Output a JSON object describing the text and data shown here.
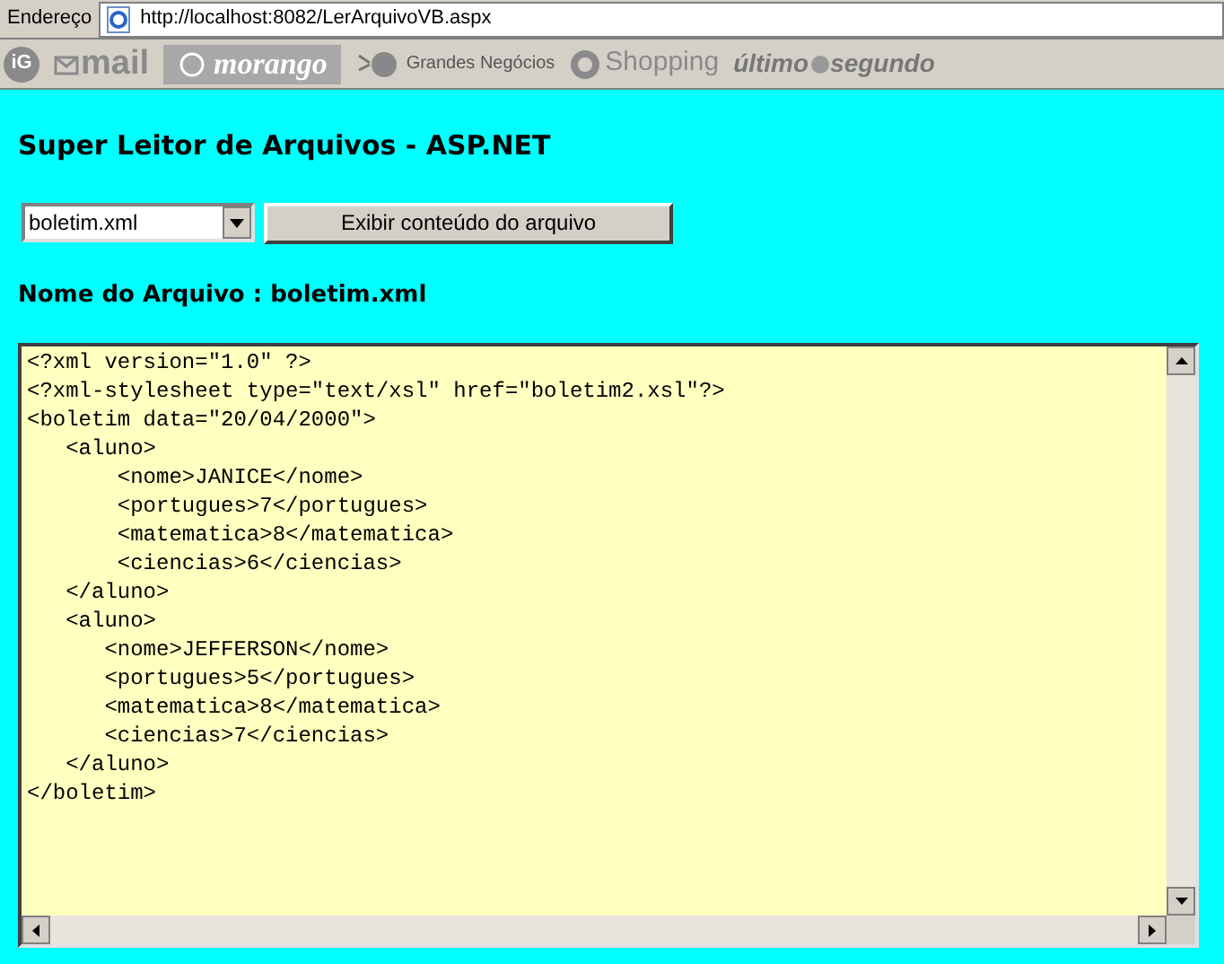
{
  "address_bar": {
    "label": "Endereço",
    "url": "http://localhost:8082/LerArquivoVB.aspx"
  },
  "links_bar": [
    {
      "kind": "logo",
      "label": "iG"
    },
    {
      "kind": "mail",
      "label": "mail"
    },
    {
      "kind": "morango",
      "label": "morango"
    },
    {
      "kind": "ball",
      "label": "Grandes Negócios"
    },
    {
      "kind": "logo-text",
      "label": "Shopping"
    },
    {
      "kind": "split",
      "label": "último",
      "label2": "segundo"
    }
  ],
  "page": {
    "title": "Super Leitor de Arquivos - ASP.NET",
    "file_select": {
      "value": "boletim.xml"
    },
    "show_button": "Exibir conteúdo do arquivo",
    "file_name_label": "Nome do Arquivo : boletim.xml",
    "file_content": [
      "<?xml version=\"1.0\" ?>",
      "<?xml-stylesheet type=\"text/xsl\" href=\"boletim2.xsl\"?>",
      "<boletim data=\"20/04/2000\">",
      "   <aluno>",
      "       <nome>JANICE</nome>",
      "       <portugues>7</portugues>",
      "       <matematica>8</matematica>",
      "       <ciencias>6</ciencias>",
      "   </aluno>",
      "   <aluno>",
      "      <nome>JEFFERSON</nome>",
      "      <portugues>5</portugues>",
      "      <matematica>8</matematica>",
      "      <ciencias>7</ciencias>",
      "   </aluno>",
      "</boletim>"
    ]
  }
}
